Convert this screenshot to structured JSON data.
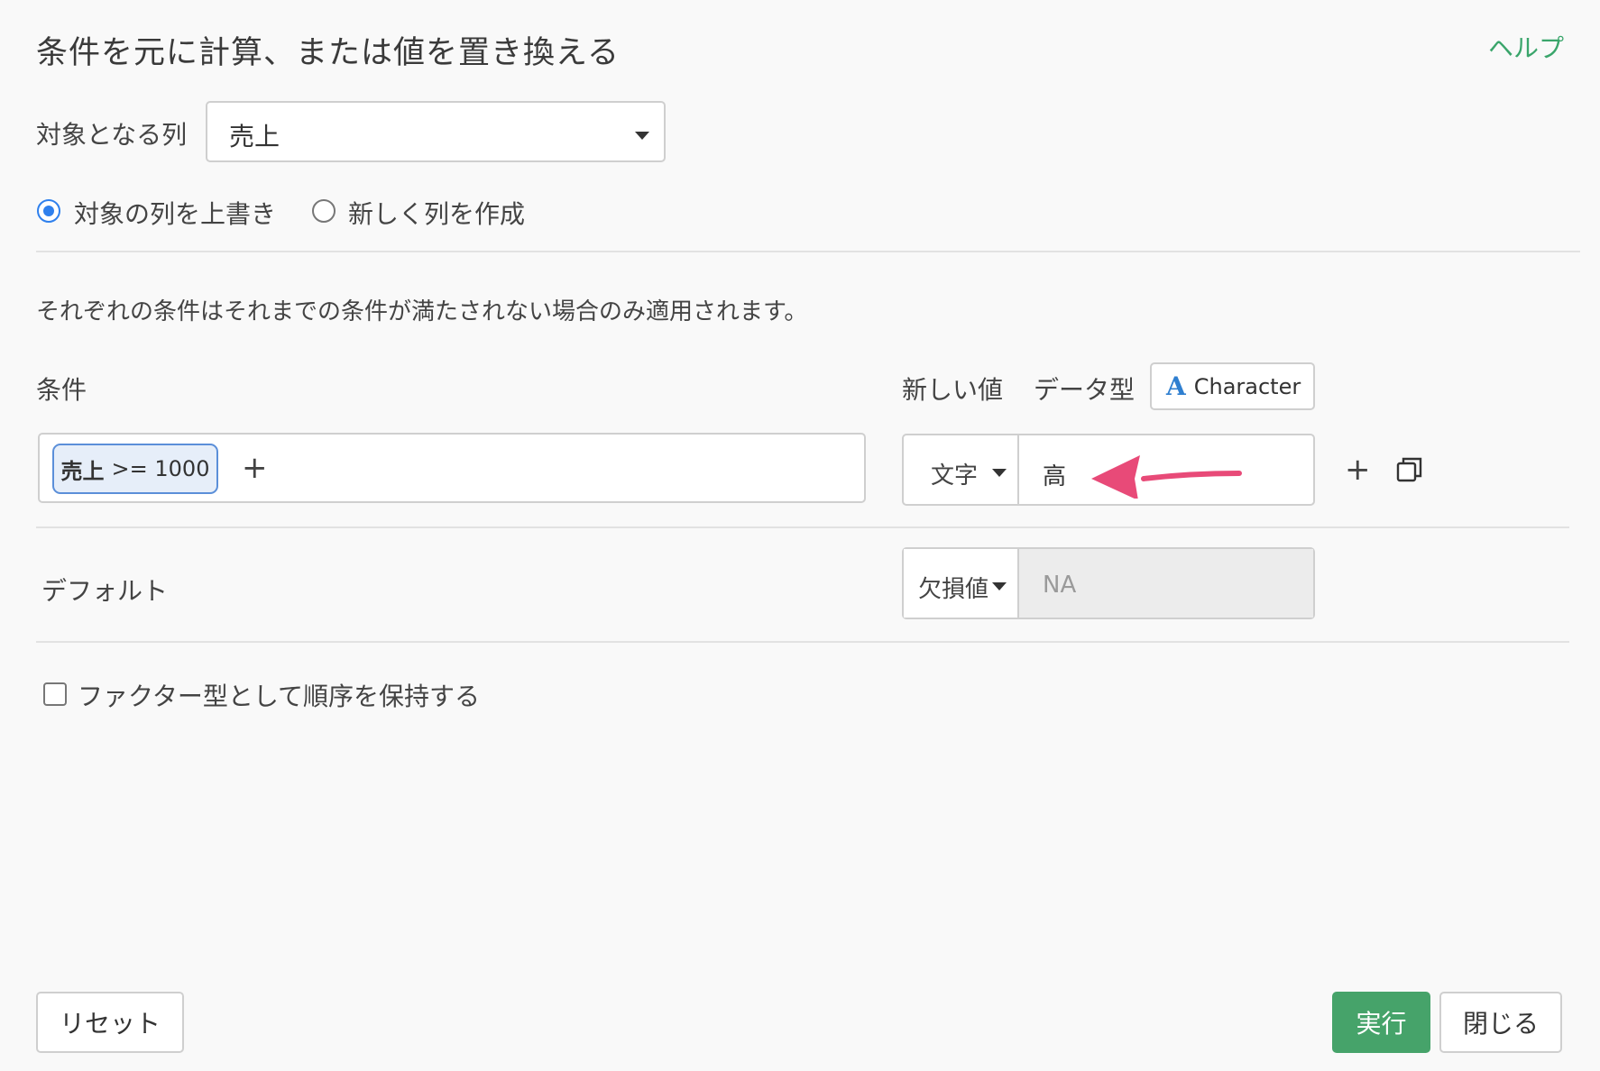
{
  "dialog": {
    "title": "条件を元に計算、または値を置き換える",
    "help_label": "ヘルプ"
  },
  "target_column": {
    "label": "対象となる列",
    "value": "売上"
  },
  "mode": {
    "overwrite_label": "対象の列を上書き",
    "new_column_label": "新しく列を作成",
    "selected": "overwrite"
  },
  "description": "それぞれの条件はそれまでの条件が満たされない場合のみ適用されます。",
  "headers": {
    "condition": "条件",
    "new_value": "新しい値",
    "data_type_label": "データ型",
    "data_type_value": "Character",
    "data_type_icon": "A"
  },
  "conditions": [
    {
      "column": "売上",
      "operator_value": ">= 1000",
      "value_type": "文字",
      "value": "高"
    }
  ],
  "default_row": {
    "label": "デフォルト",
    "type": "欠損値",
    "value": "NA"
  },
  "factor_option": {
    "label": "ファクター型として順序を保持する",
    "checked": false
  },
  "footer": {
    "reset_label": "リセット",
    "run_label": "実行",
    "close_label": "閉じる"
  },
  "colors": {
    "accent_green": "#46a36a",
    "accent_blue": "#2f80ed",
    "arrow_pink": "#e84a78"
  }
}
